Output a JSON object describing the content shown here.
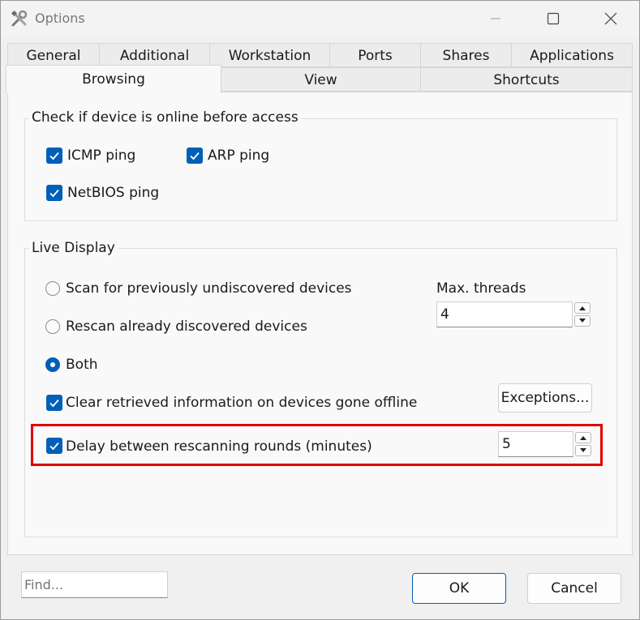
{
  "window": {
    "title": "Options"
  },
  "tabs_row1": [
    "General",
    "Additional",
    "Workstation",
    "Ports",
    "Shares",
    "Applications"
  ],
  "tabs_row2": [
    "Browsing",
    "View",
    "Shortcuts"
  ],
  "active_tab": "Browsing",
  "online_check": {
    "group_label": "Check if device is online before access",
    "icmp": {
      "label": "ICMP ping",
      "checked": true
    },
    "arp": {
      "label": "ARP ping",
      "checked": true
    },
    "netbios": {
      "label": "NetBIOS ping",
      "checked": true
    }
  },
  "live_display": {
    "group_label": "Live Display",
    "radio_scan_new": {
      "label": "Scan for previously undiscovered devices",
      "checked": false
    },
    "radio_rescan": {
      "label": "Rescan already discovered devices",
      "checked": false
    },
    "radio_both": {
      "label": "Both",
      "checked": true
    },
    "max_threads_label": "Max. threads",
    "max_threads_value": "4",
    "clear_offline": {
      "label": "Clear retrieved information on devices gone offline",
      "checked": true
    },
    "exceptions_button": "Exceptions...",
    "delay": {
      "label": "Delay between rescanning rounds (minutes)",
      "checked": true,
      "value": "5"
    }
  },
  "footer": {
    "find_placeholder": "Find...",
    "ok_label": "OK",
    "cancel_label": "Cancel"
  },
  "colors": {
    "accent": "#005fb8",
    "highlight": "#e00000"
  }
}
